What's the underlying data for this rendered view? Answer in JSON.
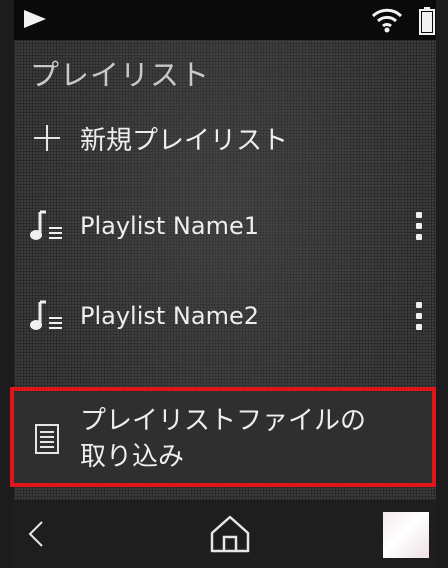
{
  "status_bar": {
    "icons": [
      "play-icon",
      "wifi-icon",
      "battery-icon"
    ]
  },
  "page_title": "プレイリスト",
  "list": {
    "new_playlist": {
      "icon": "plus-icon",
      "label": "新規プレイリスト"
    },
    "playlists": [
      {
        "icon": "playlist-note-icon",
        "name": "Playlist Name1",
        "menu_icon": "more-vert-icon"
      },
      {
        "icon": "playlist-note-icon",
        "name": "Playlist Name2",
        "menu_icon": "more-vert-icon"
      }
    ],
    "import_item": {
      "icon": "document-icon",
      "label": "プレイリストファイルの\n取り込み",
      "highlighted": true
    }
  },
  "nav_bar": {
    "icons": [
      "back-icon",
      "home-icon",
      "thumbnail"
    ]
  },
  "colors": {
    "highlight": "#e0141b",
    "background": "#3a3a3a",
    "text": "#eeeeee"
  }
}
